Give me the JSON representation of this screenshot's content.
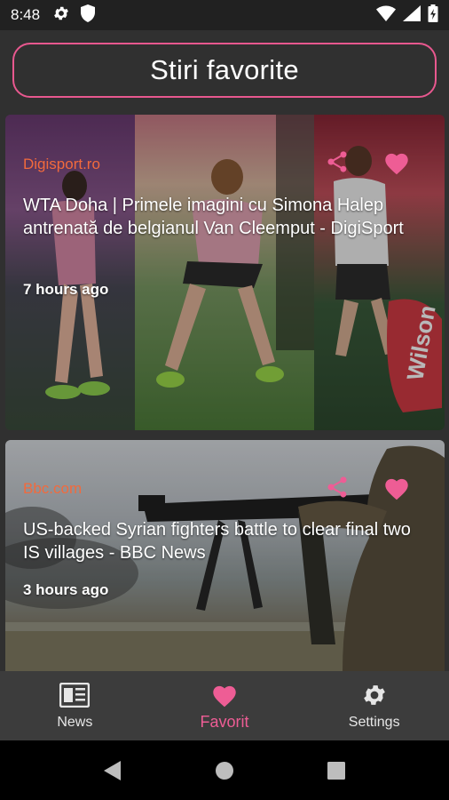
{
  "status_bar": {
    "time": "8:48"
  },
  "header": {
    "title": "Stiri favorite"
  },
  "articles": [
    {
      "source": "Digisport.ro",
      "headline": "WTA Doha | Primele imagini cu Simona Halep antrenată de belgianul Van Cleemput - DigiSport",
      "time_ago": "7 hours ago"
    },
    {
      "source": "Bbc.com",
      "headline": "US-backed Syrian fighters battle to clear final two IS villages - BBC News",
      "time_ago": "3 hours ago"
    }
  ],
  "bottom_nav": {
    "items": [
      {
        "label": "News",
        "icon": "newspaper-icon",
        "active": false
      },
      {
        "label": "Favorit",
        "icon": "heart-icon",
        "active": true
      },
      {
        "label": "Settings",
        "icon": "gear-icon",
        "active": false
      }
    ]
  },
  "colors": {
    "accent": "#ee5d95",
    "source": "#f26a3d",
    "background": "#303030",
    "nav_background": "#3c3c3c"
  }
}
